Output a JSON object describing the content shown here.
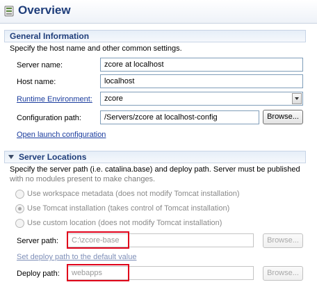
{
  "header": {
    "title": "Overview"
  },
  "general": {
    "title": "General Information",
    "description": "Specify the host name and other common settings.",
    "server_name_label": "Server name:",
    "server_name_value": "zcore at localhost",
    "host_name_label": "Host name:",
    "host_name_value": "localhost",
    "runtime_label": "Runtime Environment:",
    "runtime_value": "zcore",
    "config_path_label": "Configuration path:",
    "config_path_value": "/Servers/zcore at localhost-config",
    "browse_label": "Browse...",
    "open_launch_link": "Open launch configuration"
  },
  "locations": {
    "title": "Server Locations",
    "description_line1": "Specify the server path (i.e. catalina.base) and deploy path. Server must be published",
    "description_line2": "with no modules present to make changes.",
    "radio_workspace": "Use workspace metadata (does not modify Tomcat installation)",
    "radio_tomcat": "Use Tomcat installation (takes control of Tomcat installation)",
    "radio_custom": "Use custom location (does not modify Tomcat installation)",
    "selected_option": "Use Tomcat installation (takes control of Tomcat installation)",
    "server_path_label": "Server path:",
    "server_path_value": "C:\\zcore-base",
    "browse_label": "Browse...",
    "set_deploy_link": "Set deploy path to the default value",
    "deploy_path_label": "Deploy path:",
    "deploy_path_value": "webapps"
  },
  "colors": {
    "title": "#1e3d7a",
    "link": "#1a3c9e",
    "highlight": "#e0001a"
  }
}
